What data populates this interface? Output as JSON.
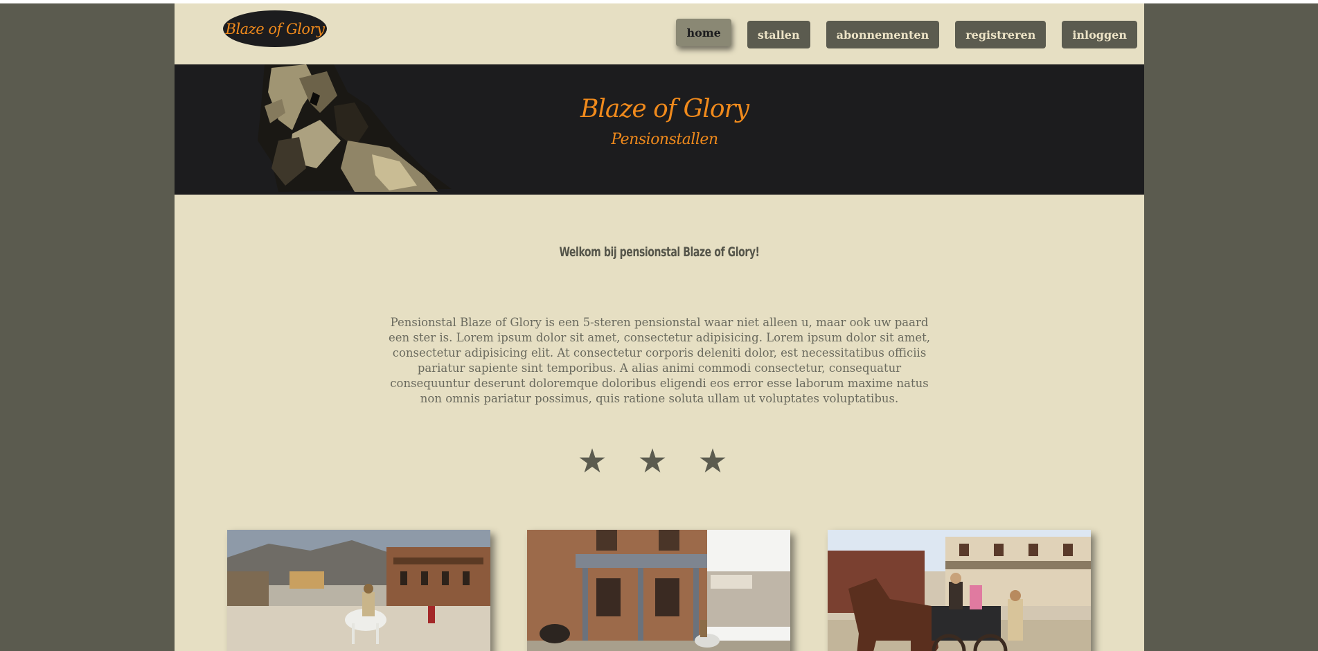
{
  "header": {
    "logo_text": "Blaze of Glory",
    "nav": [
      {
        "label": "home",
        "active": true
      },
      {
        "label": "stallen",
        "active": false
      },
      {
        "label": "abonnementen",
        "active": false
      },
      {
        "label": "registreren",
        "active": false
      },
      {
        "label": "inloggen",
        "active": false
      }
    ]
  },
  "hero": {
    "title": "Blaze of Glory",
    "subtitle": "Pensionstallen",
    "image_icon": "horse-head-illustration"
  },
  "main": {
    "heading": "Welkom bij pensionstal Blaze of Glory!",
    "intro": "Pensionstal Blaze of Glory is een 5-steren pensionstal waar niet alleen u, maar ook uw paard een ster is. Lorem ipsum dolor sit amet, consectetur adipisicing. Lorem ipsum dolor sit amet, consectetur adipisicing elit. At consectetur corporis deleniti dolor, est necessitatibus officiis pariatur sapiente sint temporibus. A alias animi commodi consectetur, consequatur consequuntur deserunt doloremque doloribus eligendi eos error esse laborum maxime natus non omnis pariatur possimus, quis ratione soluta ullam ut voluptates voluptatibus.",
    "stars": [
      "★",
      "★",
      "★"
    ],
    "photos": [
      "western-town-rider-photo",
      "western-saloon-building-photo",
      "horse-carriage-photo"
    ]
  },
  "colors": {
    "page_background": "#5b5b4f",
    "content_background": "#e6dfc3",
    "hero_background": "#1c1c1e",
    "accent_orange": "#f08a1c",
    "button_background": "#5b5b4f",
    "button_active": "#8a8874"
  }
}
